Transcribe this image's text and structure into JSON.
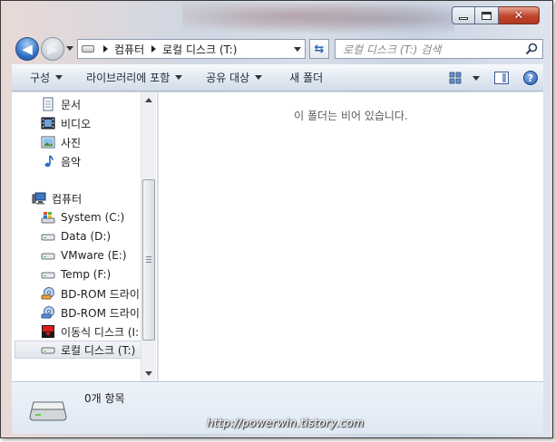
{
  "address": {
    "crumbs": [
      "컴퓨터",
      "로컬 디스크 (T:)"
    ]
  },
  "search": {
    "placeholder": "로컬 디스크 (T:) 검색"
  },
  "toolbar": {
    "organize": "구성",
    "include_in_library": "라이브러리에 포함",
    "share_with": "공유 대상",
    "new_folder": "새 폴더"
  },
  "nav": {
    "libraries": [
      {
        "label": "문서",
        "icon": "document-icon"
      },
      {
        "label": "비디오",
        "icon": "video-icon"
      },
      {
        "label": "사진",
        "icon": "picture-icon"
      },
      {
        "label": "음악",
        "icon": "music-icon"
      }
    ],
    "computer_label": "컴퓨터",
    "drives": [
      {
        "label": "System (C:)",
        "icon": "system-drive-icon"
      },
      {
        "label": "Data (D:)",
        "icon": "hard-drive-icon"
      },
      {
        "label": "VMware (E:)",
        "icon": "hard-drive-icon"
      },
      {
        "label": "Temp (F:)",
        "icon": "hard-drive-icon"
      },
      {
        "label": "BD-ROM 드라이",
        "icon": "optical-drive-icon"
      },
      {
        "label": "BD-ROM 드라이",
        "icon": "optical-drive-icon"
      },
      {
        "label": "이동식 디스크 (I:",
        "icon": "removable-disk-icon"
      },
      {
        "label": "로컬 디스크 (T:)",
        "icon": "hard-drive-icon",
        "selected": true
      }
    ]
  },
  "content": {
    "empty_message": "이 폴더는 비어 있습니다."
  },
  "status": {
    "item_count": "0개 항목",
    "watermark": "http://powerwin.tistory.com"
  },
  "colors": {
    "close_button": "#c0442a",
    "toolbar_top": "#f7f9fc",
    "status_bg": "#dfe8f3"
  }
}
